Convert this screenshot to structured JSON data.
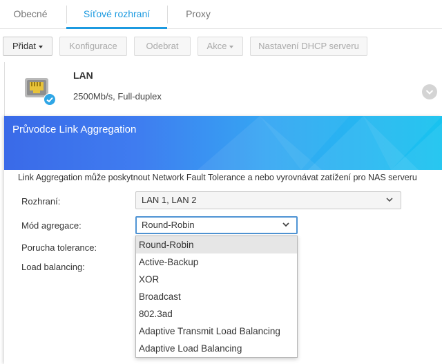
{
  "tabs": [
    {
      "label": "Obecné",
      "active": false
    },
    {
      "label": "Síťové rozhraní",
      "active": true
    },
    {
      "label": "Proxy",
      "active": false
    }
  ],
  "toolbar": {
    "add": "Přidat",
    "configure": "Konfigurace",
    "remove": "Odebrat",
    "action": "Akce",
    "dhcp": "Nastavení DHCP serveru"
  },
  "lan": {
    "name": "LAN",
    "status": "2500Mb/s, Full-duplex",
    "icon": "ethernet-port-icon",
    "connected": true
  },
  "wizard": {
    "title": "Průvodce Link Aggregation",
    "description": "Link Aggregation může poskytnout Network Fault Tolerance a nebo vyrovnávat zatížení pro NAS serveru",
    "interfaces_label": "Rozhraní:",
    "interfaces_value": "LAN 1, LAN 2",
    "mode_label": "Mód agregace:",
    "mode_value": "Round-Robin",
    "fault_label": "Porucha tolerance:",
    "lb_label": "Load balancing:"
  },
  "dropdown": {
    "selected_index": 0,
    "options": [
      "Round-Robin",
      "Active-Backup",
      "XOR",
      "Broadcast",
      "802.3ad",
      "Adaptive Transmit Load Balancing",
      "Adaptive Load Balancing"
    ]
  },
  "colors": {
    "accent": "#1c9ae0",
    "header_start": "#3a6ae8",
    "header_end": "#18c3ef",
    "focus": "#4f94d4"
  }
}
